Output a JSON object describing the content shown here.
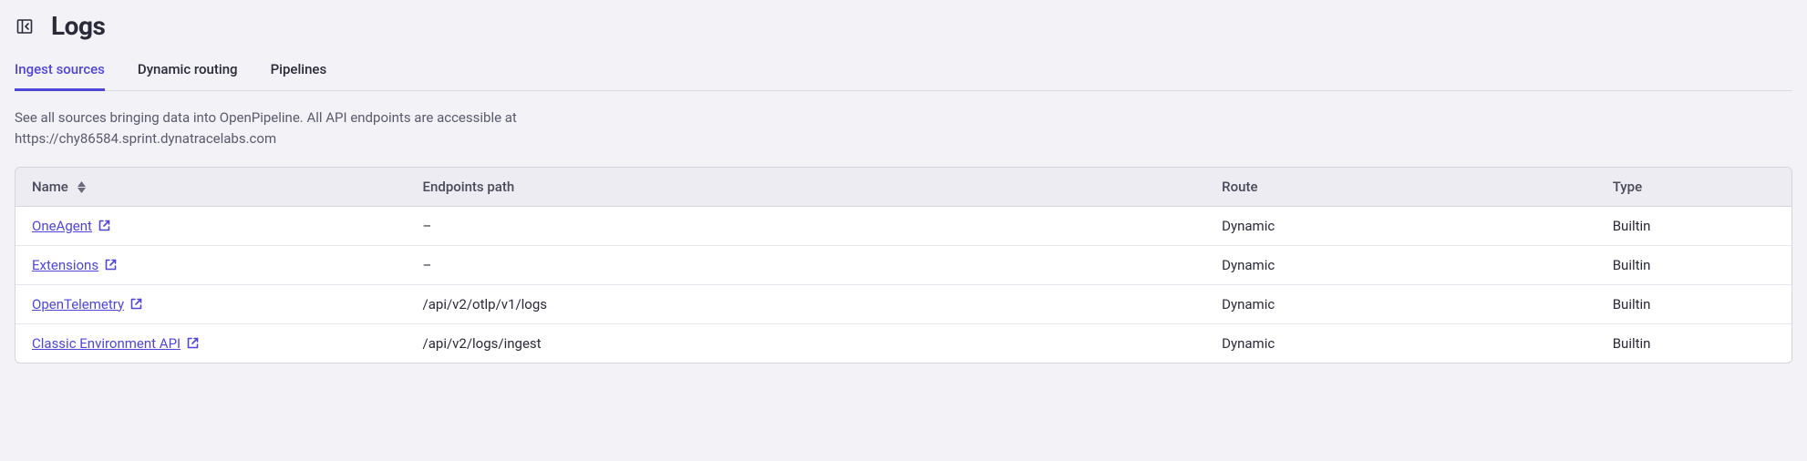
{
  "header": {
    "title": "Logs"
  },
  "tabs": [
    {
      "label": "Ingest sources",
      "active": true
    },
    {
      "label": "Dynamic routing",
      "active": false
    },
    {
      "label": "Pipelines",
      "active": false
    }
  ],
  "description": {
    "line1": "See all sources bringing data into OpenPipeline. All API endpoints are accessible at",
    "line2": "https://chy86584.sprint.dynatracelabs.com"
  },
  "table": {
    "columns": {
      "name": "Name",
      "endpoints": "Endpoints path",
      "route": "Route",
      "type": "Type"
    },
    "rows": [
      {
        "name": "OneAgent",
        "endpoints": "–",
        "route": "Dynamic",
        "type": "Builtin"
      },
      {
        "name": "Extensions",
        "endpoints": "–",
        "route": "Dynamic",
        "type": "Builtin"
      },
      {
        "name": "OpenTelemetry",
        "endpoints": "/api/v2/otlp/v1/logs",
        "route": "Dynamic",
        "type": "Builtin"
      },
      {
        "name": "Classic Environment API",
        "endpoints": "/api/v2/logs/ingest",
        "route": "Dynamic",
        "type": "Builtin"
      }
    ]
  }
}
